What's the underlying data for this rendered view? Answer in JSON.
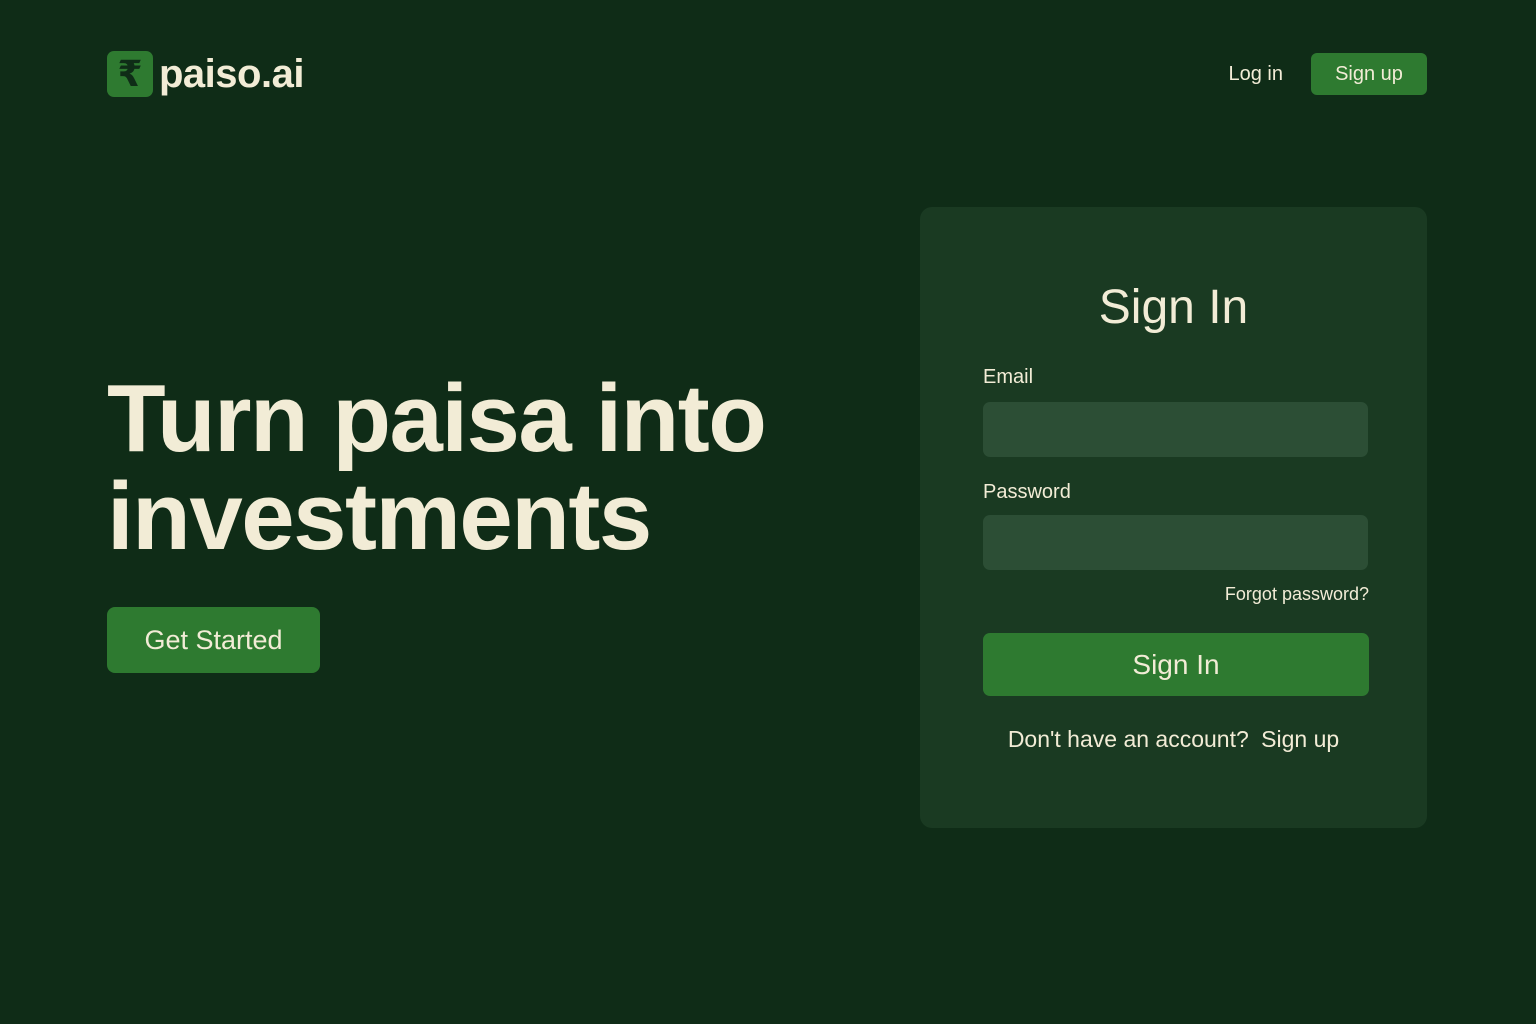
{
  "brand": {
    "logo_symbol": "₹",
    "name": "paiso.ai"
  },
  "nav": {
    "login_label": "Log in",
    "signup_label": "Sign up"
  },
  "hero": {
    "title_line1": "Turn paisa into",
    "title_line2": "investments",
    "cta_label": "Get Started"
  },
  "signin_form": {
    "title": "Sign In",
    "email_label": "Email",
    "email_value": "",
    "password_label": "Password",
    "password_value": "",
    "forgot_label": "Forgot password?",
    "submit_label": "Sign In",
    "no_account_text": "Don't have an account?",
    "signup_link_label": "Sign up"
  },
  "icons": {
    "logo": "rupee-icon"
  },
  "colors": {
    "background": "#0f2c17",
    "card": "#1a3a22",
    "input": "#2c4e35",
    "accent": "#2e7a30",
    "text": "#f2ecd6"
  }
}
